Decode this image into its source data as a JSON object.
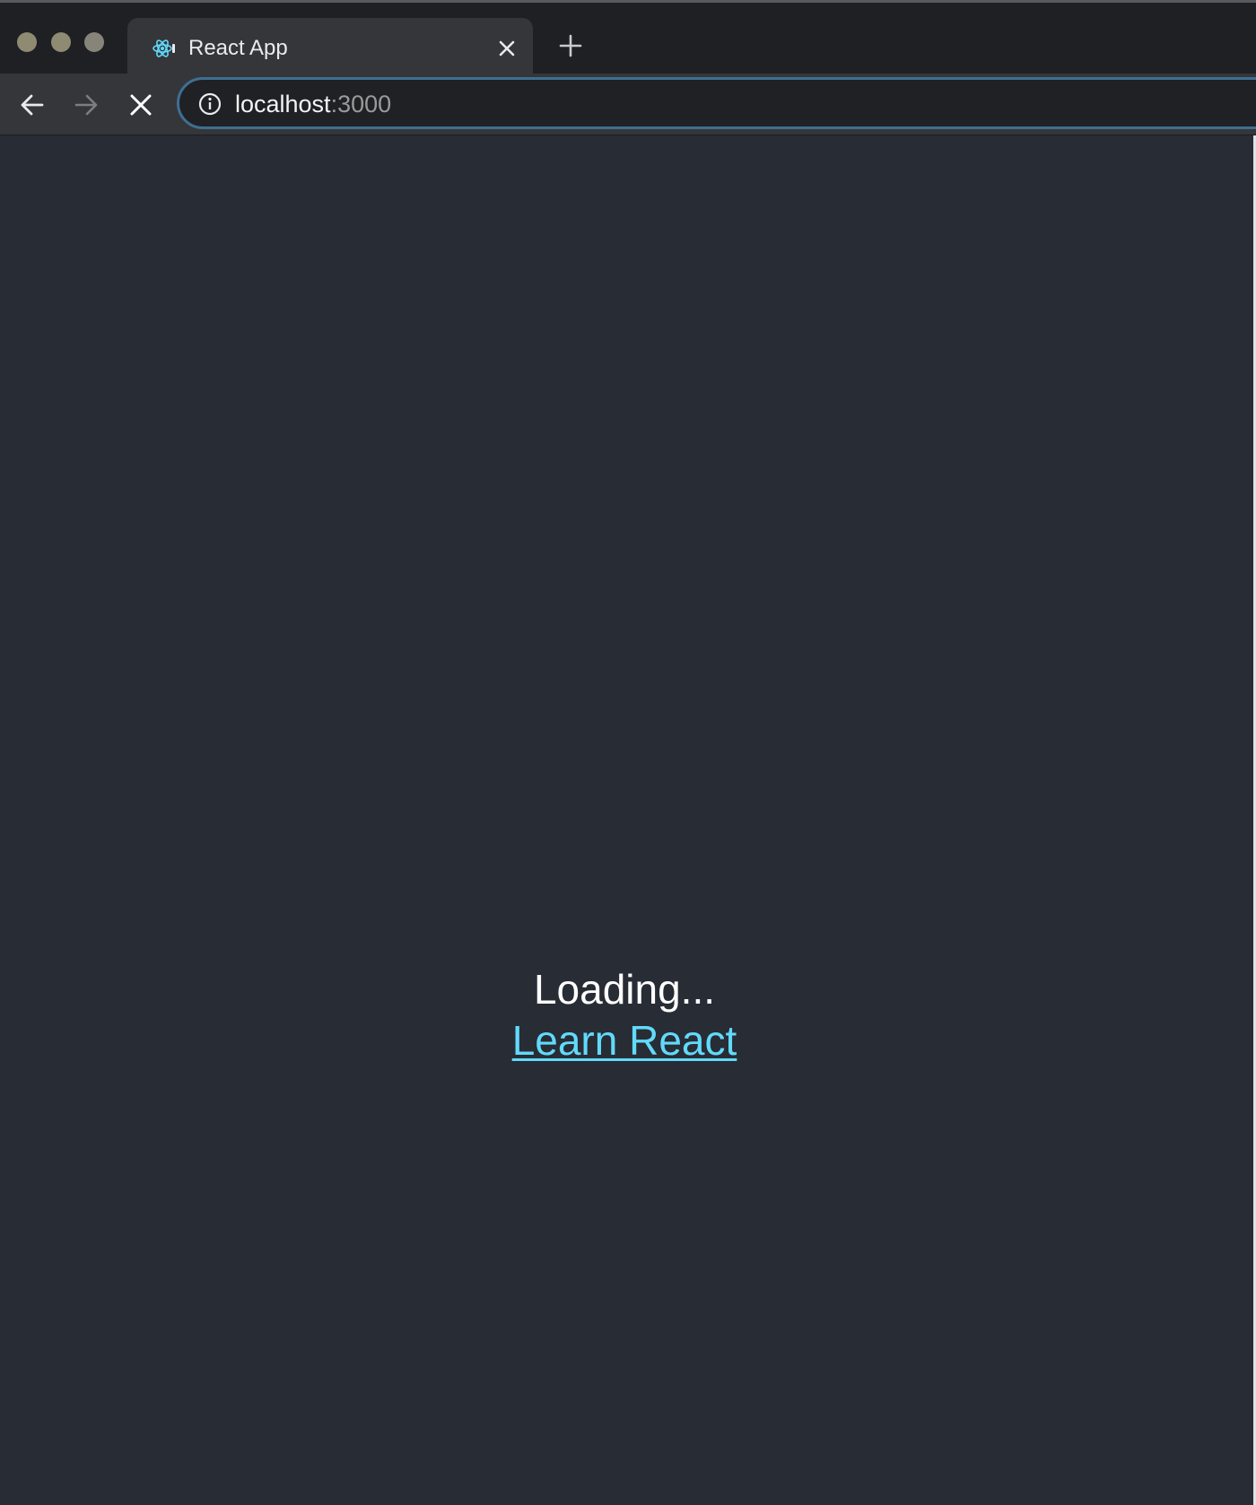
{
  "browser": {
    "tab": {
      "title": "React App",
      "favicon": "react-logo-icon"
    },
    "new_tab_icon": "plus-icon",
    "nav": {
      "back_icon": "arrow-left-icon",
      "forward_icon": "arrow-right-icon",
      "stop_icon": "close-icon"
    },
    "omnibox": {
      "security_icon": "info-icon",
      "url_host": "localhost",
      "url_port": ":3000"
    }
  },
  "page": {
    "loading_text": "Loading...",
    "link_text": "Learn React"
  },
  "colors": {
    "page_background": "#282c34",
    "link": "#61dafb",
    "loading_text": "#ffffff",
    "omnibox_focus_ring": "#3e6f93"
  }
}
